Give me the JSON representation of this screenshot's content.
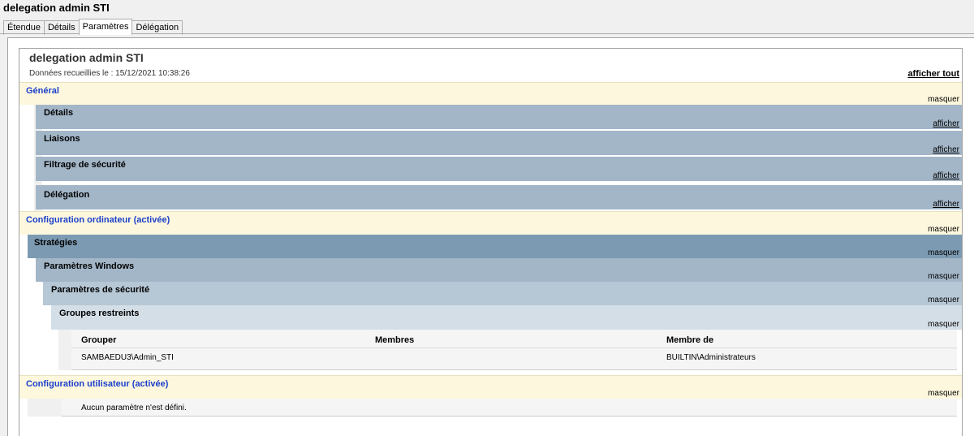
{
  "window_title": "delegation admin STI",
  "tabs": [
    {
      "label": "Étendue"
    },
    {
      "label": "Détails"
    },
    {
      "label": "Paramètres"
    },
    {
      "label": "Délégation"
    }
  ],
  "report": {
    "title": "delegation admin STI",
    "collected": "Données recueillies le : 15/12/2021 10:38:26",
    "show_all": "afficher tout",
    "general": {
      "label": "Général",
      "toggle": "masquer"
    },
    "details": {
      "label": "Détails",
      "toggle": "afficher"
    },
    "links": {
      "label": "Liaisons",
      "toggle": "afficher"
    },
    "security_filter": {
      "label": "Filtrage de sécurité",
      "toggle": "afficher"
    },
    "delegation": {
      "label": "Délégation",
      "toggle": "afficher"
    },
    "computer_config": {
      "label": "Configuration ordinateur (activée)",
      "toggle": "masquer"
    },
    "policies": {
      "label": "Stratégies",
      "toggle": "masquer"
    },
    "windows_settings": {
      "label": "Paramètres Windows",
      "toggle": "masquer"
    },
    "security_settings": {
      "label": "Paramètres de sécurité",
      "toggle": "masquer"
    },
    "restricted_groups": {
      "label": "Groupes restreints",
      "toggle": "masquer"
    },
    "groups_table": {
      "headers": [
        "Grouper",
        "Membres",
        "Membre de"
      ],
      "rows": [
        [
          "SAMBAEDU3\\Admin_STI",
          "",
          "BUILTIN\\Administrateurs"
        ]
      ]
    },
    "user_config": {
      "label": "Configuration utilisateur (activée)",
      "toggle": "masquer"
    },
    "no_settings": "Aucun paramètre n'est défini."
  }
}
